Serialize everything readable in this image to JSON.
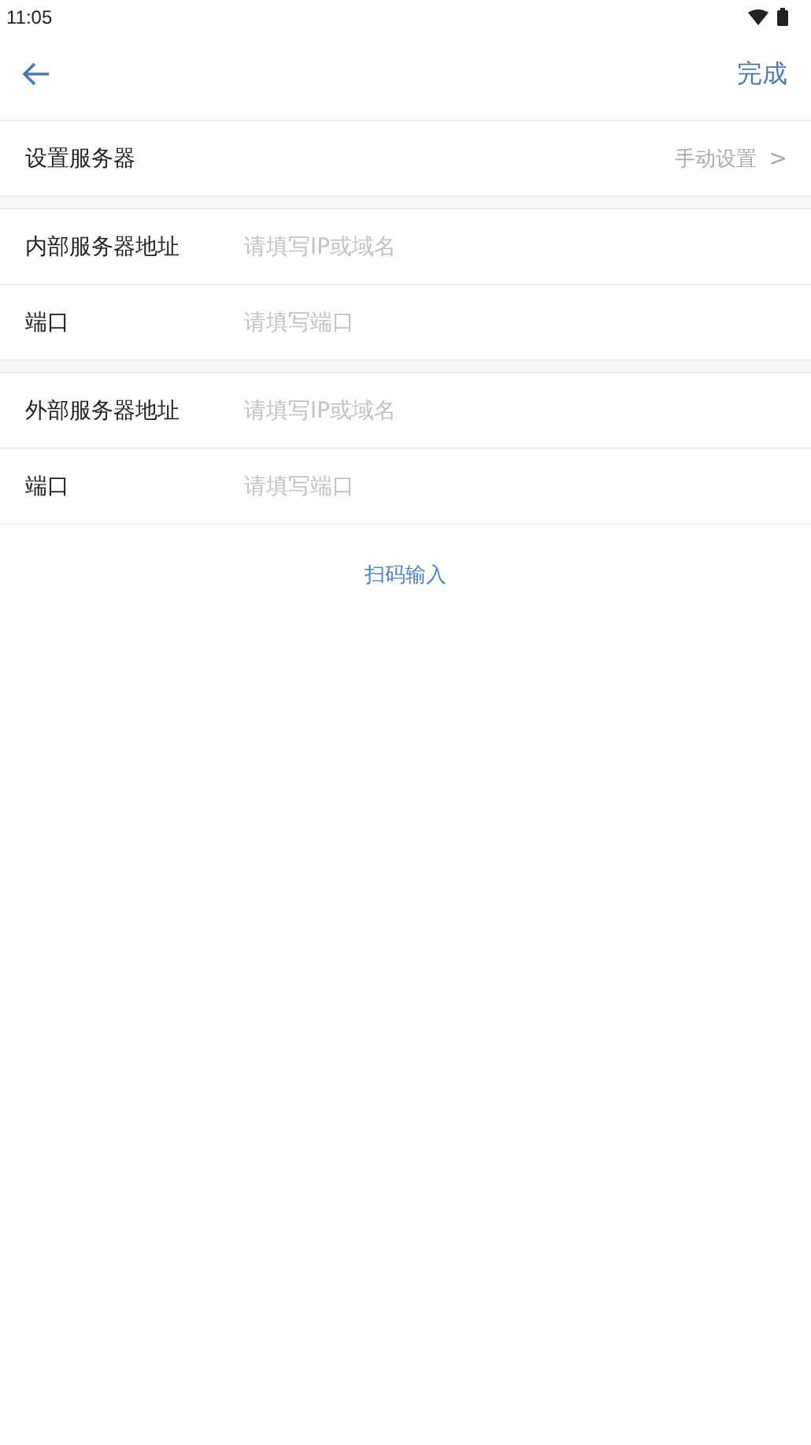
{
  "status_bar": {
    "time": "11:05"
  },
  "header": {
    "done": "完成"
  },
  "server_setting": {
    "label": "设置服务器",
    "value": "手动设置",
    "chevron": ">"
  },
  "groups": [
    {
      "fields": [
        {
          "label": "内部服务器地址",
          "placeholder": "请填写IP或域名"
        },
        {
          "label": "端口",
          "placeholder": "请填写端口"
        }
      ]
    },
    {
      "fields": [
        {
          "label": "外部服务器地址",
          "placeholder": "请填写IP或域名"
        },
        {
          "label": "端口",
          "placeholder": "请填写端口"
        }
      ]
    }
  ],
  "scan_link": "扫码输入"
}
